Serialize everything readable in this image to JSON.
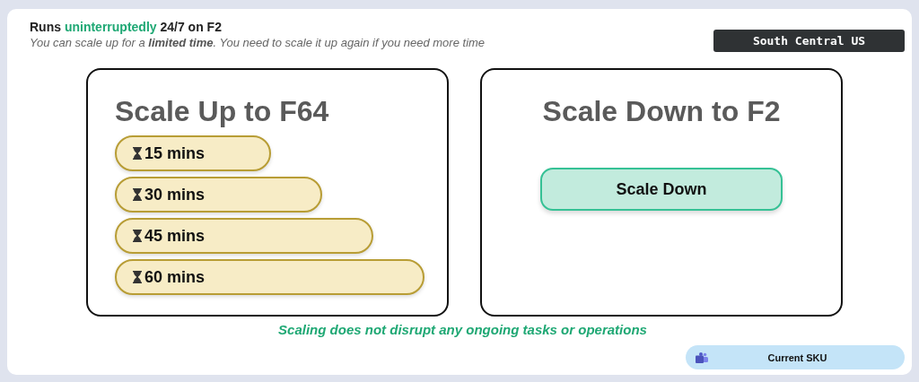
{
  "header": {
    "title": "Runs **uninterruptedly** 24/7 on F2",
    "subtitle": "You can scale up for a **limited time**. You need to scale it up again if you need more time"
  },
  "region": "South Central US",
  "scale_up": {
    "title": "Scale Up to F64",
    "options": [
      {
        "label": "15 mins"
      },
      {
        "label": "30 mins"
      },
      {
        "label": "45 mins"
      },
      {
        "label": "60 mins"
      }
    ]
  },
  "scale_down": {
    "title": "Scale Down to F2",
    "button": "Scale Down"
  },
  "footer_note": "Scaling does not disrupt any ongoing tasks or operations",
  "current_sku": {
    "label": "Current SKU"
  }
}
